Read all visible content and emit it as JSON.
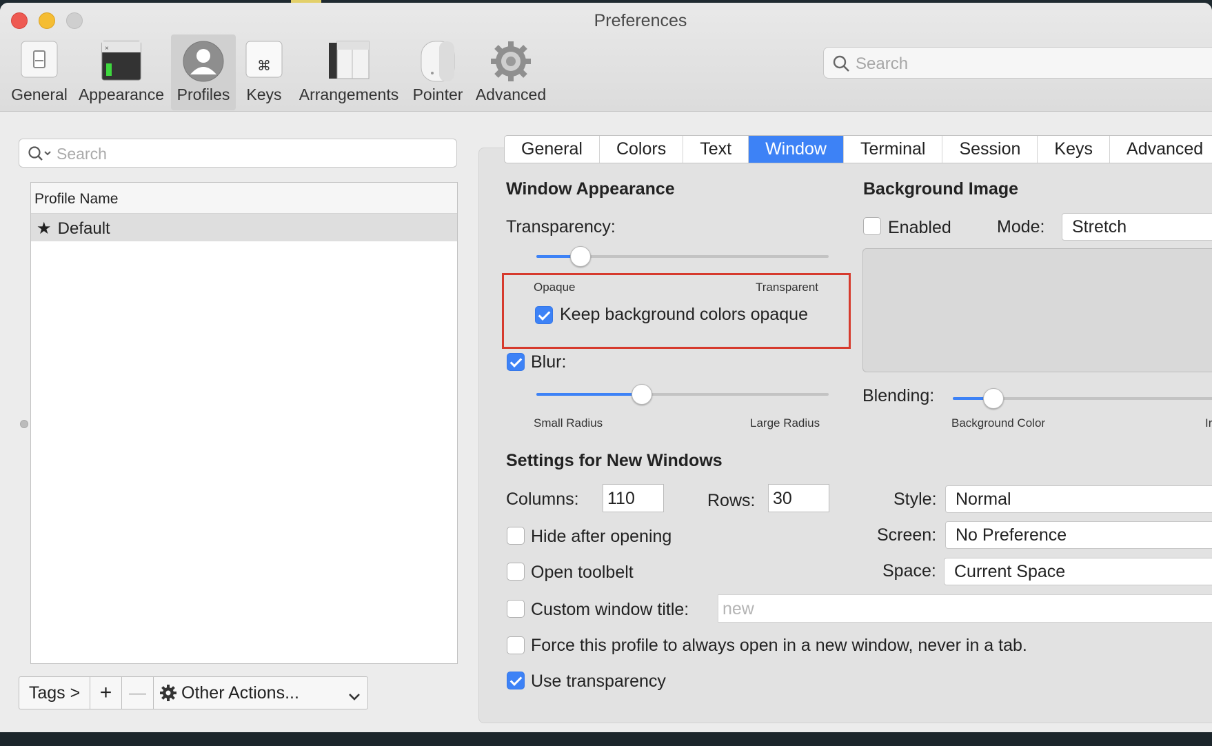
{
  "window": {
    "title": "Preferences"
  },
  "toolbar": {
    "items": [
      {
        "label": "General",
        "icon": "general-icon"
      },
      {
        "label": "Appearance",
        "icon": "appearance-icon"
      },
      {
        "label": "Profiles",
        "icon": "profiles-icon",
        "selected": true
      },
      {
        "label": "Keys",
        "icon": "command-key-icon"
      },
      {
        "label": "Arrangements",
        "icon": "arrangements-icon"
      },
      {
        "label": "Pointer",
        "icon": "mouse-icon"
      },
      {
        "label": "Advanced",
        "icon": "gear-icon"
      }
    ],
    "search_placeholder": "Search"
  },
  "profiles": {
    "search_placeholder": "Search",
    "column_header": "Profile Name",
    "rows": [
      {
        "name": "Default",
        "default": true
      }
    ],
    "bottom_bar": {
      "tags_label": "Tags >",
      "add_label": "+",
      "remove_label": "—",
      "other_actions_label": "Other Actions..."
    }
  },
  "tabs": {
    "items": [
      "General",
      "Colors",
      "Text",
      "Window",
      "Terminal",
      "Session",
      "Keys",
      "Advanced"
    ],
    "selected": "Window"
  },
  "window_appearance": {
    "heading": "Window Appearance",
    "transparency_label": "Transparency:",
    "transparency_value": 0.15,
    "opaque_label": "Opaque",
    "transparent_label": "Transparent",
    "keep_bg_opaque_label": "Keep background colors opaque",
    "keep_bg_opaque_checked": true,
    "blur_label": "Blur:",
    "blur_checked": true,
    "blur_value": 0.36,
    "small_radius_label": "Small Radius",
    "large_radius_label": "Large Radius"
  },
  "background_image": {
    "heading": "Background Image",
    "enabled_label": "Enabled",
    "enabled_checked": false,
    "mode_label": "Mode:",
    "mode_value": "Stretch",
    "blending_label": "Blending:",
    "blending_value": 0.14,
    "background_color_label": "Background Color",
    "image_label_partial": "Ir"
  },
  "new_windows": {
    "heading": "Settings for New Windows",
    "columns_label": "Columns:",
    "columns_value": "110",
    "rows_label": "Rows:",
    "rows_value": "30",
    "style_label": "Style:",
    "style_value": "Normal",
    "screen_label": "Screen:",
    "screen_value": "No Preference",
    "space_label": "Space:",
    "space_value": "Current Space",
    "hide_after_opening_label": "Hide after opening",
    "hide_after_opening_checked": false,
    "open_toolbelt_label": "Open toolbelt",
    "open_toolbelt_checked": false,
    "custom_title_label": "Custom window title:",
    "custom_title_checked": false,
    "custom_title_placeholder": "new",
    "force_new_window_label": "Force this profile to always open in a new window, never in a tab.",
    "force_new_window_checked": false,
    "use_transparency_label": "Use transparency",
    "use_transparency_checked": true
  },
  "colors": {
    "accent": "#3d82f6",
    "highlight_box": "#d63a2d"
  }
}
